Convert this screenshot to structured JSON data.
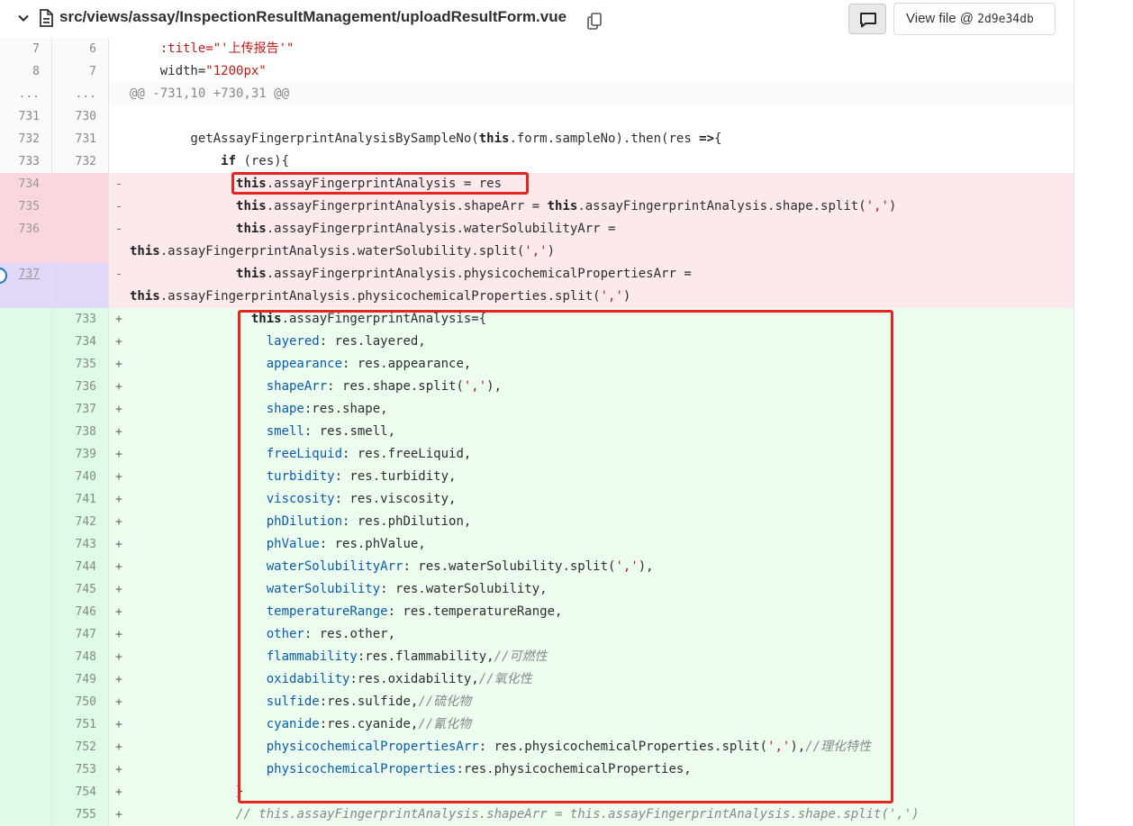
{
  "file_header": {
    "path": "src/views/assay/InspectionResultManagement/uploadResultForm.vue",
    "view_file_label": "View file @ ",
    "commit_sha": "2d9e34db"
  },
  "lines": [
    {
      "type": "ctx",
      "old": "7",
      "new": "6",
      "html": "    <span class=\"str\">:title=\"'上传报告'\"</span>"
    },
    {
      "type": "ctx",
      "old": "8",
      "new": "7",
      "html": "    width=<span class=\"str\">\"1200px\"</span>"
    },
    {
      "type": "match",
      "old": "...",
      "new": "...",
      "html": "@@ -731,10 +730,31 @@"
    },
    {
      "type": "ctx",
      "old": "731",
      "new": "730",
      "html": ""
    },
    {
      "type": "ctx",
      "old": "732",
      "new": "731",
      "html": "        getAssayFingerprintAnalysisBySampleNo(<span class=\"kw\">this</span>.form.sampleNo).then(res <span class=\"kw\">=&gt;</span>{"
    },
    {
      "type": "ctx",
      "old": "733",
      "new": "732",
      "html": "            <span class=\"kw\">if</span> (res){"
    },
    {
      "type": "del",
      "old": "734",
      "new": "",
      "sign": "-",
      "html": "              <span class=\"kw\">this</span>.assayFingerprintAnalysis = res"
    },
    {
      "type": "del",
      "old": "735",
      "new": "",
      "sign": "-",
      "html": "              <span class=\"kw\">this</span>.assayFingerprintAnalysis.shapeArr = <span class=\"kw\">this</span>.assayFingerprintAnalysis.shape.split(<span class=\"str\">','</span>)"
    },
    {
      "type": "del",
      "old": "736",
      "new": "",
      "sign": "-",
      "tall": true,
      "html": "              <span class=\"kw\">this</span>.assayFingerprintAnalysis.waterSolubilityArr =",
      "html2": "<span class=\"kw\">this</span>.assayFingerprintAnalysis.waterSolubility.split(<span class=\"str\">','</span>)"
    },
    {
      "type": "del sel",
      "old": "737",
      "new": "",
      "sign": "-",
      "tall": true,
      "link": true,
      "html": "              <span class=\"kw\">this</span>.assayFingerprintAnalysis.physicochemicalPropertiesArr =",
      "html2": "<span class=\"kw\">this</span>.assayFingerprintAnalysis.physicochemicalProperties.split(<span class=\"str\">','</span>)"
    },
    {
      "type": "add",
      "old": "",
      "new": "733",
      "sign": "+",
      "html": "                <span class=\"kw\">this</span>.assayFingerprintAnalysis={"
    },
    {
      "type": "add",
      "old": "",
      "new": "734",
      "sign": "+",
      "html": "                  <span class=\"prop\">layered</span>: res.layered,"
    },
    {
      "type": "add",
      "old": "",
      "new": "735",
      "sign": "+",
      "html": "                  <span class=\"prop\">appearance</span>: res.appearance,"
    },
    {
      "type": "add",
      "old": "",
      "new": "736",
      "sign": "+",
      "html": "                  <span class=\"prop\">shapeArr</span>: res.shape.split(<span class=\"str\">','</span>),"
    },
    {
      "type": "add",
      "old": "",
      "new": "737",
      "sign": "+",
      "html": "                  <span class=\"prop\">shape</span>:res.shape,"
    },
    {
      "type": "add",
      "old": "",
      "new": "738",
      "sign": "+",
      "html": "                  <span class=\"prop\">smell</span>: res.smell,"
    },
    {
      "type": "add",
      "old": "",
      "new": "739",
      "sign": "+",
      "html": "                  <span class=\"prop\">freeLiquid</span>: res.freeLiquid,"
    },
    {
      "type": "add",
      "old": "",
      "new": "740",
      "sign": "+",
      "html": "                  <span class=\"prop\">turbidity</span>: res.turbidity,"
    },
    {
      "type": "add",
      "old": "",
      "new": "741",
      "sign": "+",
      "html": "                  <span class=\"prop\">viscosity</span>: res.viscosity,"
    },
    {
      "type": "add",
      "old": "",
      "new": "742",
      "sign": "+",
      "html": "                  <span class=\"prop\">phDilution</span>: res.phDilution,"
    },
    {
      "type": "add",
      "old": "",
      "new": "743",
      "sign": "+",
      "html": "                  <span class=\"prop\">phValue</span>: res.phValue,"
    },
    {
      "type": "add",
      "old": "",
      "new": "744",
      "sign": "+",
      "html": "                  <span class=\"prop\">waterSolubilityArr</span>: res.waterSolubility.split(<span class=\"str\">','</span>),"
    },
    {
      "type": "add",
      "old": "",
      "new": "745",
      "sign": "+",
      "html": "                  <span class=\"prop\">waterSolubility</span>: res.waterSolubility,"
    },
    {
      "type": "add",
      "old": "",
      "new": "746",
      "sign": "+",
      "html": "                  <span class=\"prop\">temperatureRange</span>: res.temperatureRange,"
    },
    {
      "type": "add",
      "old": "",
      "new": "747",
      "sign": "+",
      "html": "                  <span class=\"prop\">other</span>: res.other,"
    },
    {
      "type": "add",
      "old": "",
      "new": "748",
      "sign": "+",
      "html": "                  <span class=\"prop\">flammability</span>:res.flammability,<span class=\"cmt\">//可燃性</span>"
    },
    {
      "type": "add",
      "old": "",
      "new": "749",
      "sign": "+",
      "html": "                  <span class=\"prop\">oxidability</span>:res.oxidability,<span class=\"cmt\">//氧化性</span>"
    },
    {
      "type": "add",
      "old": "",
      "new": "750",
      "sign": "+",
      "html": "                  <span class=\"prop\">sulfide</span>:res.sulfide,<span class=\"cmt\">//硫化物</span>"
    },
    {
      "type": "add",
      "old": "",
      "new": "751",
      "sign": "+",
      "html": "                  <span class=\"prop\">cyanide</span>:res.cyanide,<span class=\"cmt\">//氰化物</span>"
    },
    {
      "type": "add",
      "old": "",
      "new": "752",
      "sign": "+",
      "html": "                  <span class=\"prop\">physicochemicalPropertiesArr</span>: res.physicochemicalProperties.split(<span class=\"str\">','</span>),<span class=\"cmt\">//理化特性</span>"
    },
    {
      "type": "add",
      "old": "",
      "new": "753",
      "sign": "+",
      "html": "                  <span class=\"prop\">physicochemicalProperties</span>:res.physicochemicalProperties,"
    },
    {
      "type": "add",
      "old": "",
      "new": "754",
      "sign": "+",
      "html": "              }"
    },
    {
      "type": "add",
      "old": "",
      "new": "755",
      "sign": "+",
      "html": "              <span class=\"cmt\">// this.assayFingerprintAnalysis.shapeArr = this.assayFingerprintAnalysis.shape.split(',')</span>"
    }
  ]
}
